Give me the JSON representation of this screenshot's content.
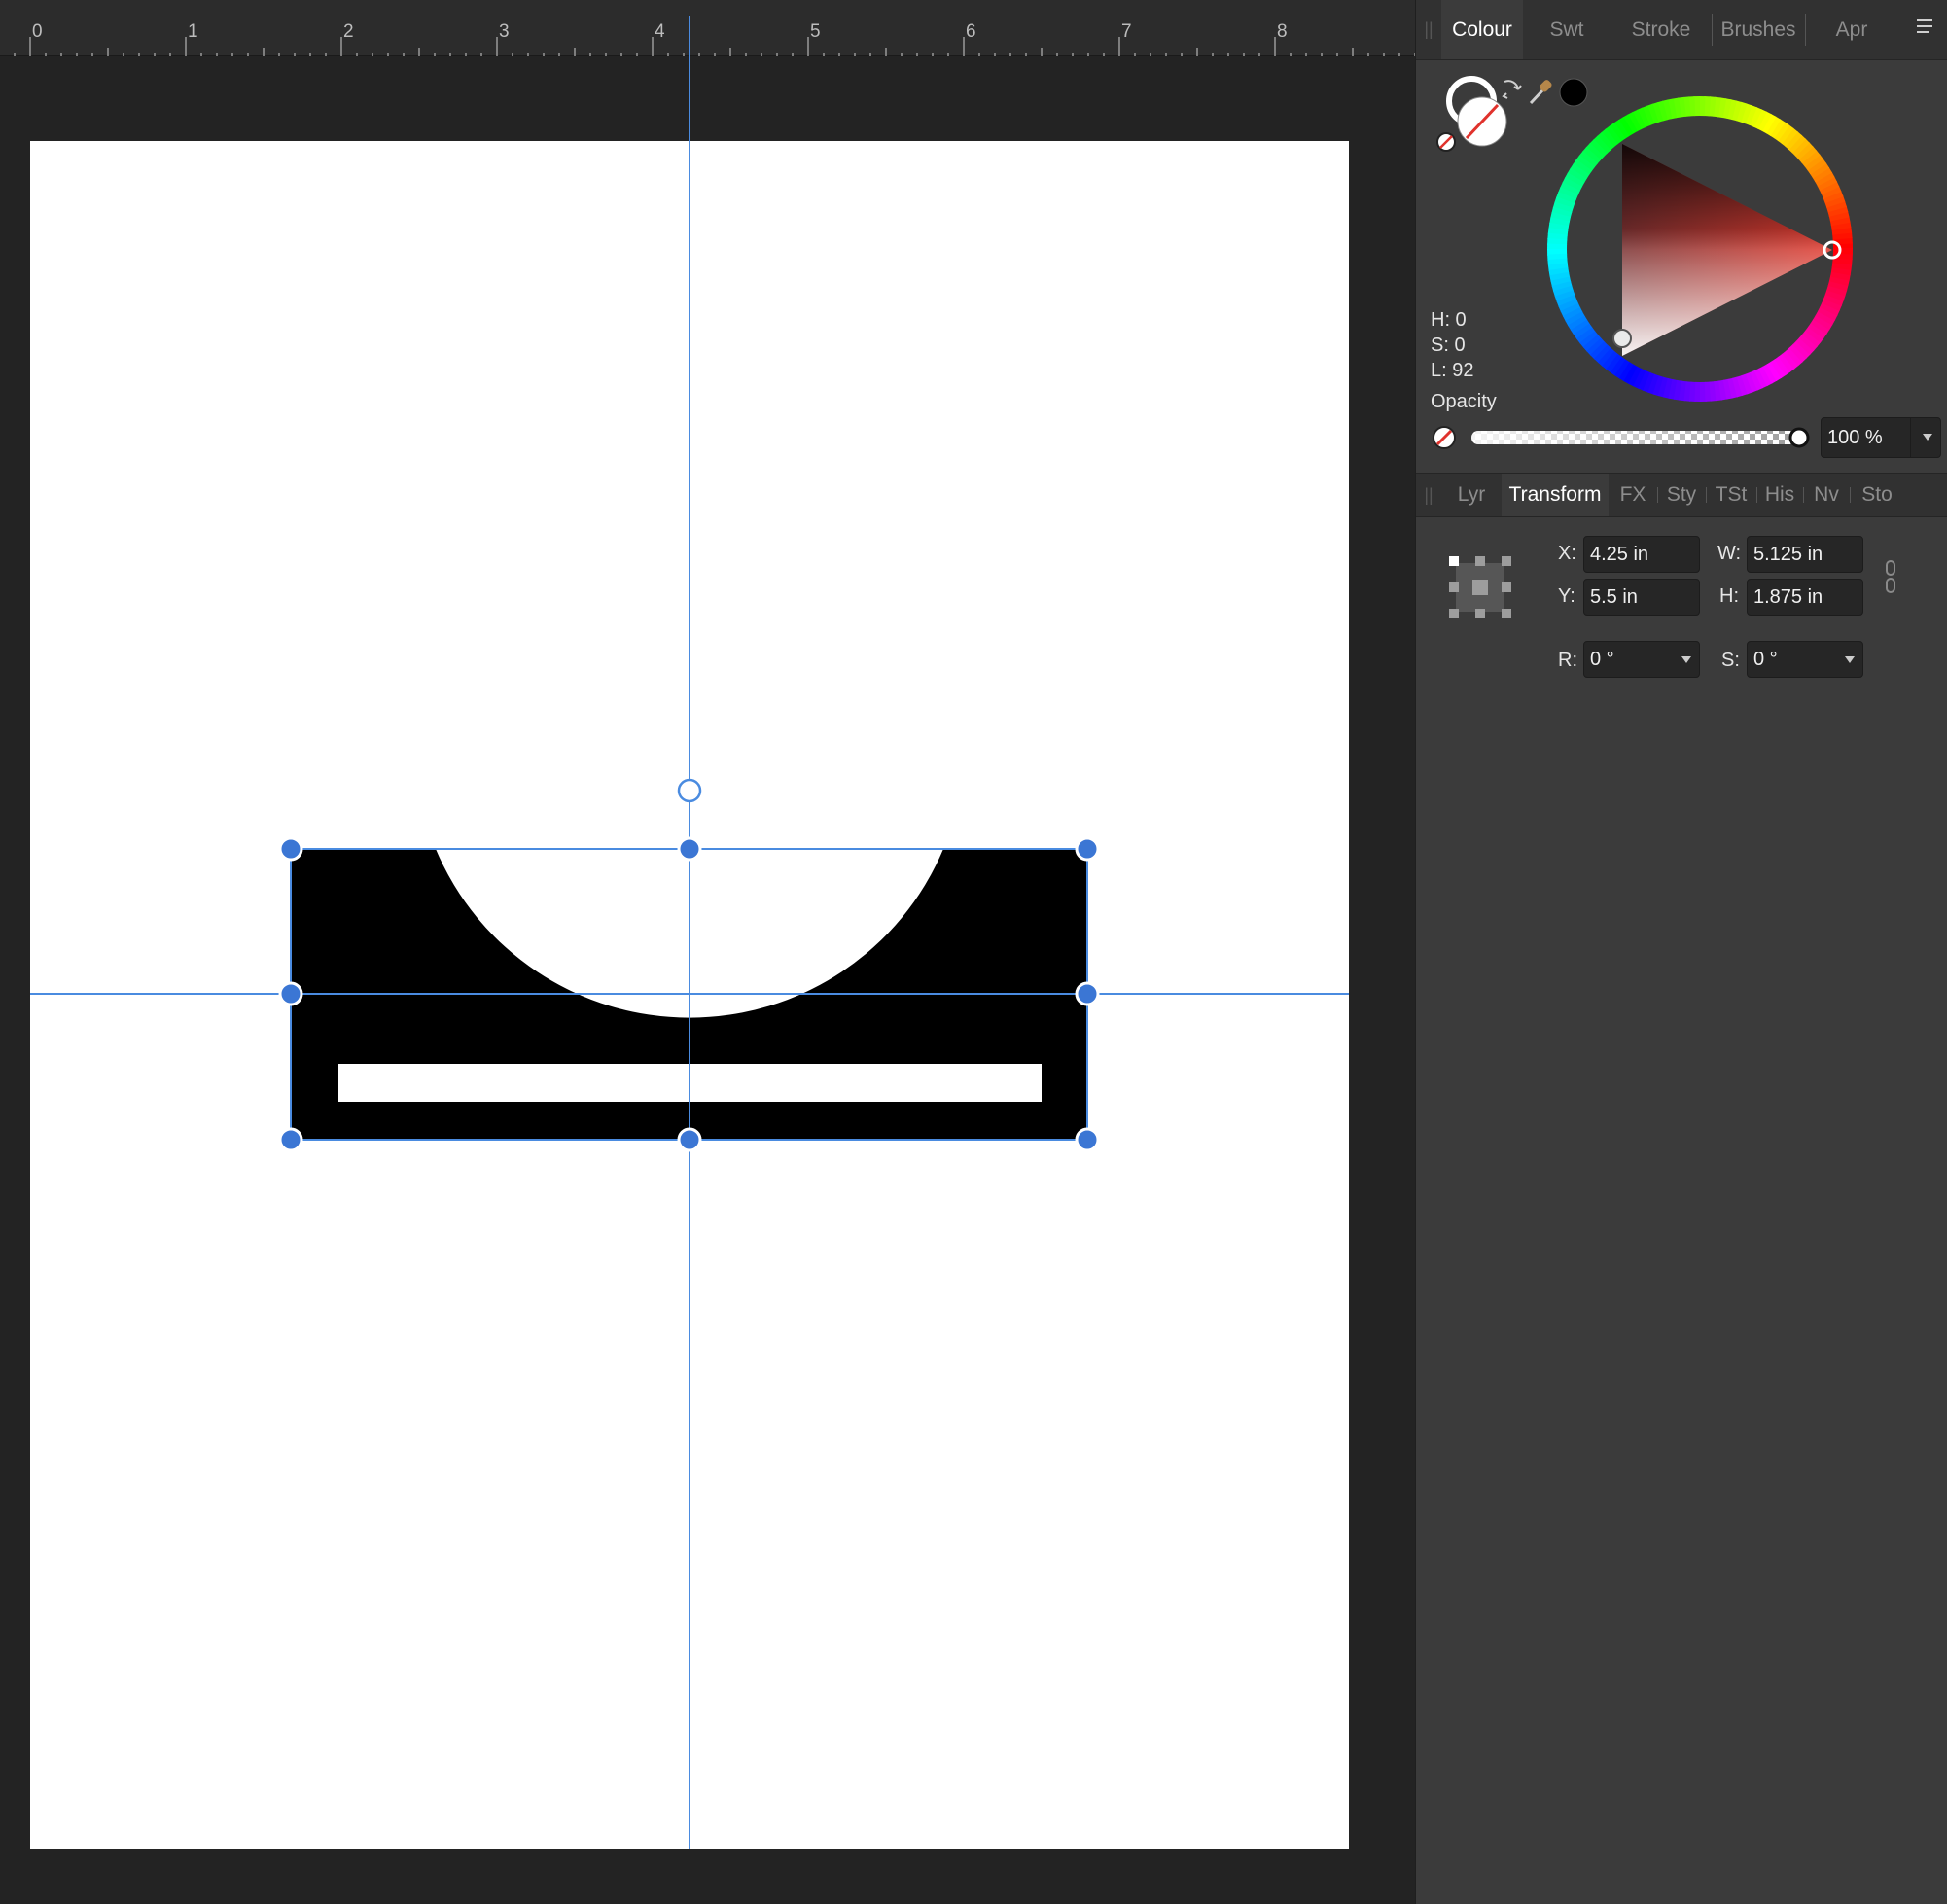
{
  "ruler": {
    "ticks": [
      "0",
      "1",
      "2",
      "3",
      "4",
      "5",
      "6",
      "7",
      "8"
    ]
  },
  "colour_panel": {
    "tabs": [
      "Colour",
      "Swt",
      "Stroke",
      "Brushes",
      "Apr"
    ],
    "active_tab": "Colour",
    "h": "H: 0",
    "s": "S: 0",
    "l": "L: 92",
    "opacity_label": "Opacity",
    "opacity_value": "100 %",
    "opacity_fraction": 1.0,
    "fill_colour": "#ffffff",
    "stroke_colour": "#000000"
  },
  "transform_panel": {
    "tabs": [
      "Lyr",
      "Transform",
      "FX",
      "Sty",
      "TSt",
      "His",
      "Nv",
      "Sto"
    ],
    "active_tab": "Transform",
    "x_label": "X:",
    "x_value": "4.25 in",
    "y_label": "Y:",
    "y_value": "5.5 in",
    "w_label": "W:",
    "w_value": "5.125 in",
    "h_label": "H:",
    "h_value": "1.875 in",
    "r_label": "R:",
    "r_value": "0 °",
    "s_label": "S:",
    "s_value": "0 °"
  },
  "colors": {
    "accent": "#3b76d4",
    "guide": "#4a8be0",
    "shape": "#000000"
  }
}
